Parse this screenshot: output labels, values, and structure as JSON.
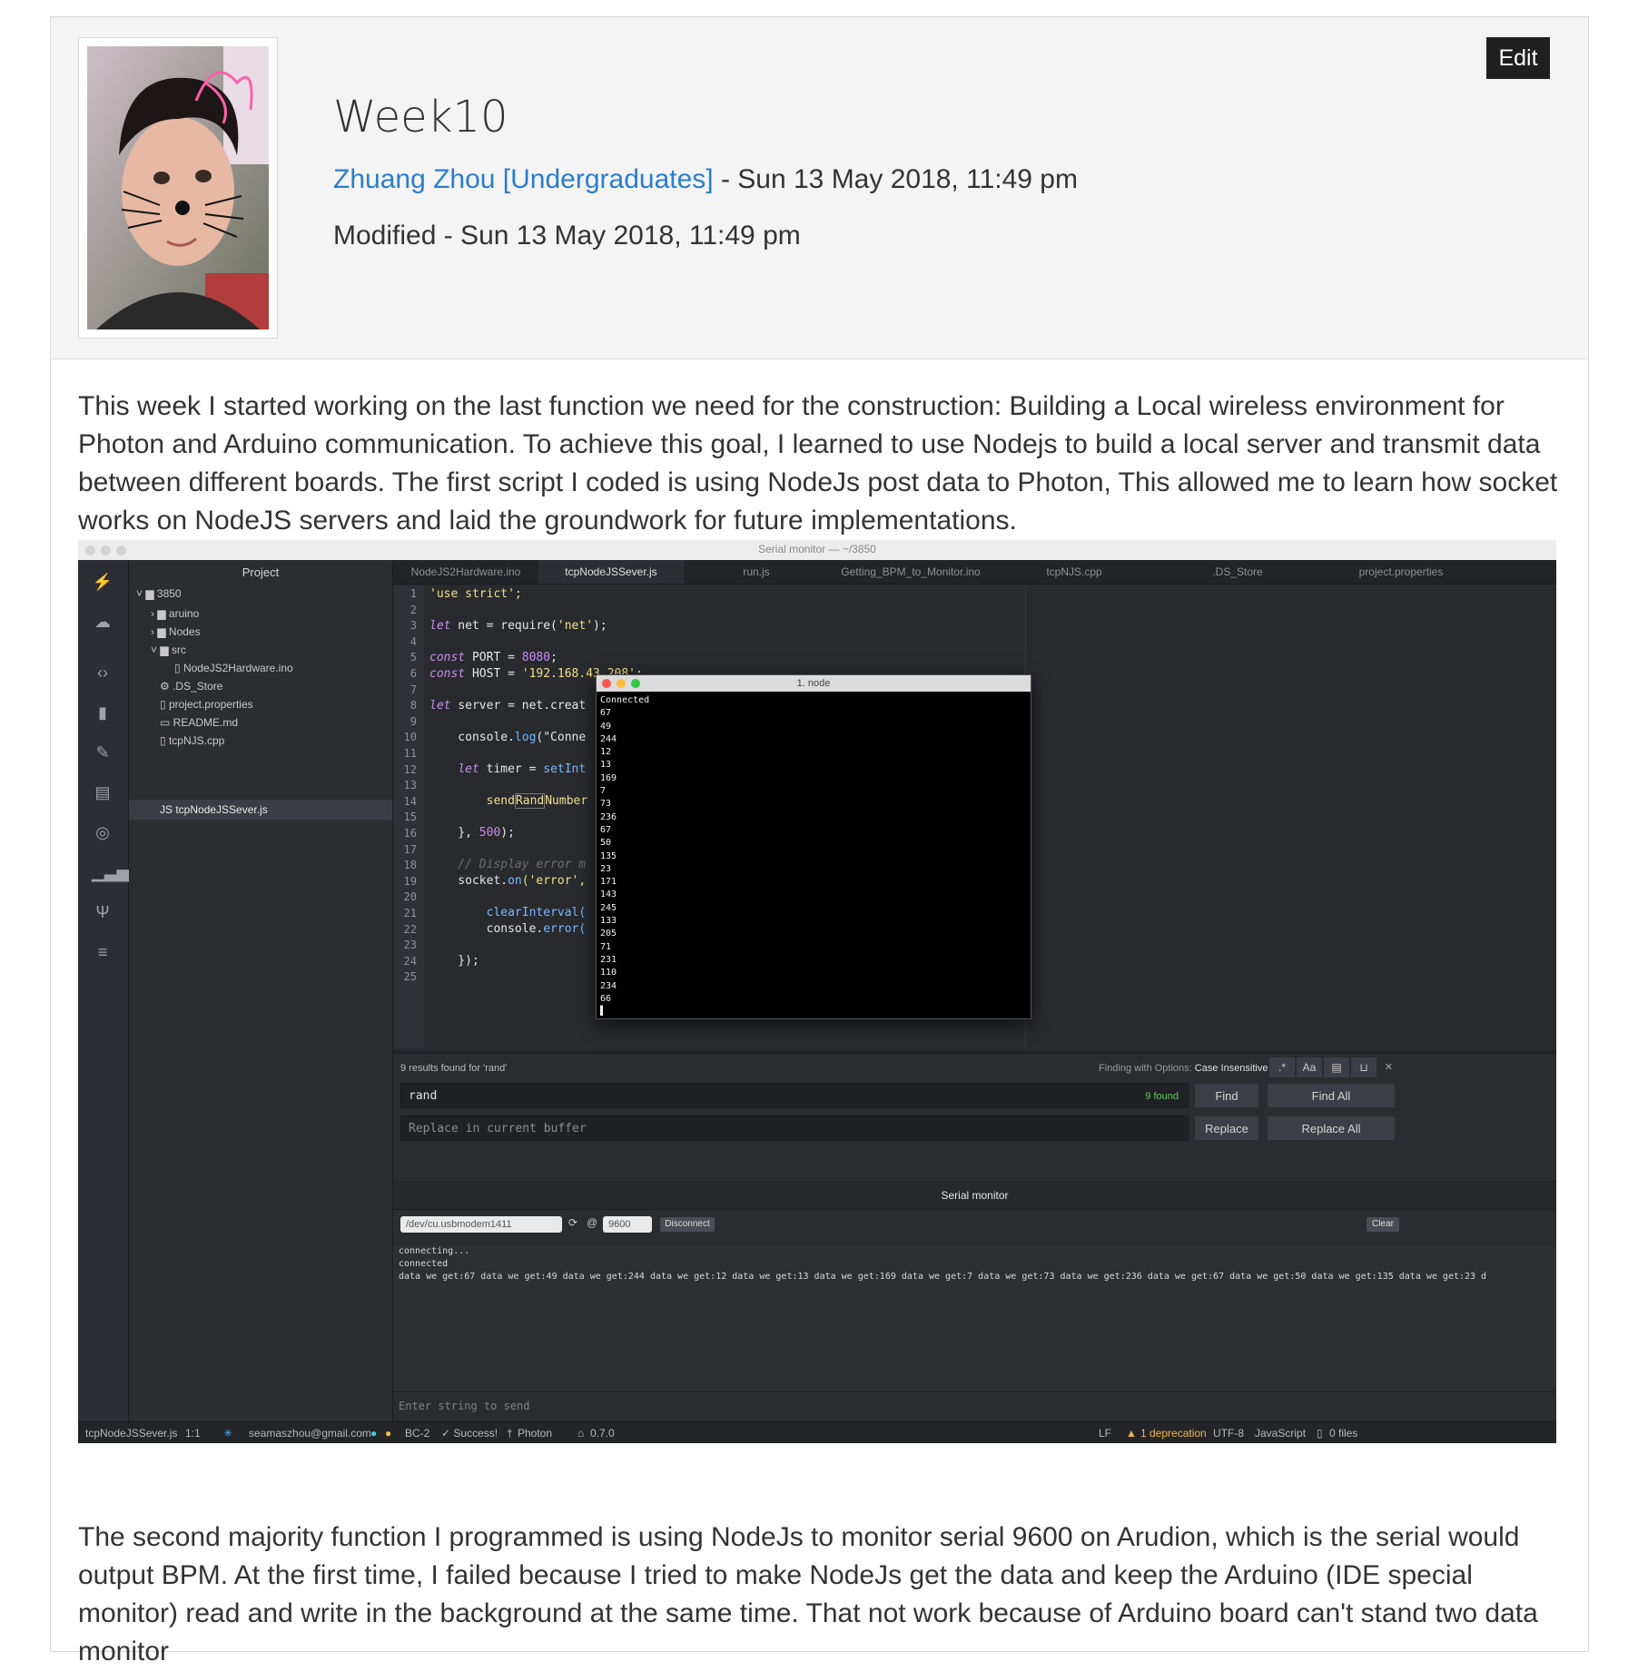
{
  "post": {
    "title": "Week10",
    "author": "Zhuang Zhou [Undergraduates]",
    "date_sep": " - Sun 13 May 2018, 11:49 pm",
    "modified": "Modified - Sun 13 May 2018, 11:49 pm",
    "edit_label": "Edit",
    "para1": "This week I started working on the last function we need for the construction: Building a Local wireless environment for Photon and Arduino communication. To achieve this goal, I learned to use Nodejs to build a local server and transmit data between different boards. The first script I coded is using NodeJs post data to Photon, This allowed me to learn how socket works on NodeJS servers and laid the groundwork for future implementations.",
    "para2": "The second majority function I programmed is using NodeJs to monitor serial 9600 on Arudion, which is the serial would output BPM. At the first time, I failed because I tried to make NodeJs get the data and keep the Arduino (IDE special monitor) read and write in the background at the same time. That not work because of Arduino board can't stand two data monitor"
  },
  "screenshot": {
    "window_title": "Serial monitor — ~/3850",
    "project_header": "Project",
    "tree": [
      "3850",
      "aruino",
      "Nodes",
      "src",
      "NodeJS2Hardware.ino",
      ".DS_Store",
      "project.properties",
      "README.md",
      "tcpNJS.cpp",
      "tcpNodeJSSever.js"
    ],
    "tabs": [
      "NodeJS2Hardware.ino",
      "tcpNodeJSSever.js",
      "run.js",
      "Getting_BPM_to_Monitor.ino",
      "tcpNJS.cpp",
      ".DS_Store",
      "project.properties"
    ],
    "line_numbers": [
      "1",
      "2",
      "3",
      "4",
      "5",
      "6",
      "7",
      "8",
      "9",
      "10",
      "11",
      "12",
      "13",
      "14",
      "15",
      "16",
      "17",
      "18",
      "19",
      "20",
      "21",
      "22",
      "23",
      "24",
      "25"
    ],
    "code": {
      "l1": "'use strict';",
      "l3a": "let",
      "l3b": " net = require(",
      "l3c": "'net'",
      "l3d": ");",
      "l5a": "const",
      "l5b": " PORT = ",
      "l5c": "8080",
      "l5d": ";",
      "l6a": "const",
      "l6b": " HOST = ",
      "l6c": "'192.168.43.208'",
      "l6d": ";",
      "l8a": "let",
      "l8b": " server = net.creat",
      "l10a": "    console.",
      "l10b": "log",
      "l10c": "(\"Conne",
      "l12a": "    ",
      "l12b": "let",
      "l12c": " timer = ",
      "l12d": "setInt",
      "l14a": "        send",
      "l14b": "Rand",
      "l14c": "Number",
      "l16a": "    }, ",
      "l16b": "500",
      "l16c": ");",
      "l18": "    // Display error m",
      "l19a": "    socket.",
      "l19b": "on",
      "l19c": "('error',",
      "l21a": "        ",
      "l21b": "clearInterval(",
      "l22a": "        console.",
      "l22b": "error(",
      "l24": "    });"
    },
    "find": {
      "results_text": "9 results found for 'rand'",
      "options_label": "Finding with Options:",
      "options_value": "Case Insensitive",
      "opt_regex": ".*",
      "opt_case": "Aa",
      "query": "rand",
      "found_count": "9 found",
      "find_label": "Find",
      "find_all_label": "Find All",
      "replace_placeholder": "Replace in current buffer",
      "replace_label": "Replace",
      "replace_all_label": "Replace All",
      "close": "×"
    },
    "serial": {
      "title": "Serial monitor",
      "port": "/dev/cu.usbmodem1411",
      "at": "@",
      "baud": "9600",
      "disconnect_label": "Disconnect",
      "clear_label": "Clear",
      "output": "connecting...\nconnected\ndata we get:67 data we get:49 data we get:244 data we get:12 data we get:13 data we get:169 data we get:7 data we get:73 data we get:236 data we get:67 data we get:50 data we get:135 data we get:23 d",
      "send_placeholder": "Enter string to send"
    },
    "terminal": {
      "title": "1. node",
      "output": "Connected\n67\n49\n244\n12\n13\n169\n7\n73\n236\n67\n50\n135\n23\n171\n143\n245\n133\n205\n71\n231\n110\n234\n66\n▌"
    },
    "status": {
      "file": "tcpNodeJSSever.js",
      "pos": "1:1",
      "email": "seamaszhou@gmail.com",
      "device": "BC-2",
      "success": "✓ Success!",
      "platform": "Photon",
      "version": "0.7.0",
      "lf": "LF",
      "deprecation": "1 deprecation",
      "encoding": "UTF-8",
      "grammar": "JavaScript",
      "files": "0 files"
    }
  }
}
